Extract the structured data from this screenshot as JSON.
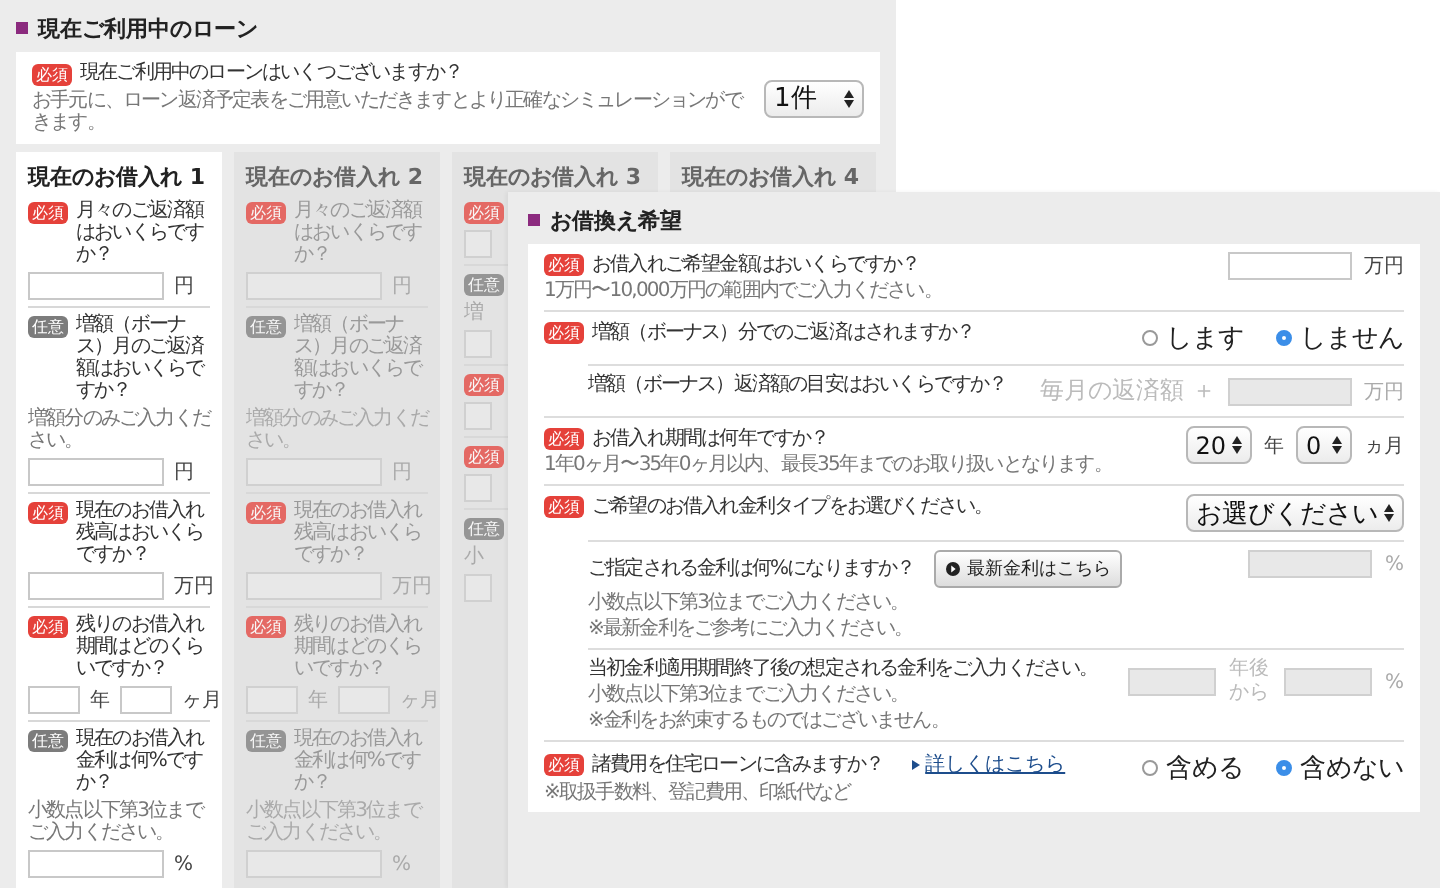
{
  "current_loans": {
    "heading": "現在ご利用中のローン",
    "count_question": {
      "badge": {
        "kind": "required",
        "text": "必須"
      },
      "question": "現在ご利用中のローンはいくつございますか？",
      "hint": "お手元に、ローン返済予定表をご用意いただきますとより正確なシミュレーションができます。",
      "select": "1件"
    },
    "columns": [
      {
        "title": "現在のお借入れ 1",
        "disabled": false,
        "items": [
          {
            "badge": {
              "kind": "required",
              "text": "必須"
            },
            "question": "月々のご返済額はおいくらですか？",
            "fields": [
              {
                "kind": "wide",
                "unit": "円"
              }
            ]
          },
          {
            "badge": {
              "kind": "optional",
              "text": "任意"
            },
            "question": "増額（ボーナス）月のご返済額はおいくらですか？",
            "hint": "増額分のみご入力ください。",
            "fields": [
              {
                "kind": "wide",
                "unit": "円"
              }
            ]
          },
          {
            "badge": {
              "kind": "required",
              "text": "必須"
            },
            "question": "現在のお借入れ残高はおいくらですか？",
            "fields": [
              {
                "kind": "wide",
                "unit": "万円"
              }
            ]
          },
          {
            "badge": {
              "kind": "required",
              "text": "必須"
            },
            "question": "残りのお借入れ期間はどのくらいですか？",
            "fields": [
              {
                "kind": "narrow",
                "unit": "年"
              },
              {
                "kind": "narrow",
                "unit": "ヶ月"
              }
            ]
          },
          {
            "badge": {
              "kind": "optional",
              "text": "任意"
            },
            "question": "現在のお借入れ金利は何%ですか？",
            "hint": "小数点以下第3位までご入力ください。",
            "fields": [
              {
                "kind": "wide",
                "unit": "%"
              }
            ]
          }
        ]
      },
      {
        "title": "現在のお借入れ 2",
        "disabled": true,
        "items": [
          {
            "badge": {
              "kind": "required",
              "text": "必須"
            },
            "question": "月々のご返済額はおいくらですか？",
            "fields": [
              {
                "kind": "wide",
                "unit": "円"
              }
            ]
          },
          {
            "badge": {
              "kind": "optional",
              "text": "任意"
            },
            "question": "増額（ボーナス）月のご返済額はおいくらですか？",
            "hint": "増額分のみご入力ください。",
            "fields": [
              {
                "kind": "wide",
                "unit": "円"
              }
            ]
          },
          {
            "badge": {
              "kind": "required",
              "text": "必須"
            },
            "question": "現在のお借入れ残高はおいくらですか？",
            "fields": [
              {
                "kind": "wide",
                "unit": "万円"
              }
            ]
          },
          {
            "badge": {
              "kind": "required",
              "text": "必須"
            },
            "question": "残りのお借入れ期間はどのくらいですか？",
            "fields": [
              {
                "kind": "narrow",
                "unit": "年"
              },
              {
                "kind": "narrow",
                "unit": "ヶ月"
              }
            ]
          },
          {
            "badge": {
              "kind": "optional",
              "text": "任意"
            },
            "question": "現在のお借入れ金利は何%ですか？",
            "hint": "小数点以下第3位までご入力ください。",
            "fields": [
              {
                "kind": "wide",
                "unit": "%"
              }
            ]
          }
        ]
      },
      {
        "title": "現在のお借入れ 3",
        "disabled": true,
        "items": [
          {
            "badge": {
              "kind": "required",
              "text": "必須"
            },
            "fields": [
              {
                "kind": "stub"
              }
            ]
          },
          {
            "badge": {
              "kind": "optional",
              "text": "任意"
            },
            "hint": "増",
            "fields": [
              {
                "kind": "stub"
              }
            ]
          },
          {
            "badge": {
              "kind": "required",
              "text": "必須"
            },
            "fields": [
              {
                "kind": "stub"
              }
            ]
          },
          {
            "badge": {
              "kind": "required",
              "text": "必須"
            },
            "fields": [
              {
                "kind": "stub"
              }
            ]
          },
          {
            "badge": {
              "kind": "optional",
              "text": "任意"
            },
            "hint": "小",
            "fields": [
              {
                "kind": "stub"
              }
            ]
          }
        ]
      },
      {
        "title": "現在のお借入れ 4",
        "disabled": true
      }
    ]
  },
  "refinance": {
    "heading": "お借換え希望",
    "rows": [
      {
        "kind": "main",
        "badge": {
          "kind": "required",
          "text": "必須"
        },
        "question": "お借入れご希望金額はおいくらですか？",
        "hints": [
          "1万円〜10,000万円の範囲内でご入力ください。"
        ],
        "disabled": false,
        "controls": [
          {
            "kind": "input"
          },
          {
            "kind": "unit",
            "text": "万円"
          }
        ]
      },
      {
        "kind": "main",
        "badge": {
          "kind": "required",
          "text": "必須"
        },
        "question": "増額（ボーナス）分でのご返済はされますか？",
        "controls": [
          {
            "kind": "radio",
            "text": "します",
            "selected": false
          },
          {
            "kind": "radio",
            "text": "しません",
            "selected": true
          }
        ]
      },
      {
        "kind": "sub",
        "question": "増額（ボーナス）返済額の目安はおいくらですか？",
        "disabled": true,
        "controls": [
          {
            "kind": "label",
            "text": "毎月の返済額 ＋"
          },
          {
            "kind": "input"
          },
          {
            "kind": "unit",
            "text": "万円"
          }
        ]
      },
      {
        "kind": "main",
        "badge": {
          "kind": "required",
          "text": "必須"
        },
        "question": "お借入れ期間は何年ですか？",
        "hints": [
          "1年0ヶ月〜35年0ヶ月以内、最長35年までのお取り扱いとなります。"
        ],
        "disabled": false,
        "controls": [
          {
            "kind": "select",
            "text": "20"
          },
          {
            "kind": "unit",
            "text": "年"
          },
          {
            "kind": "select",
            "text": "0"
          },
          {
            "kind": "unit",
            "text": "ヵ月"
          }
        ]
      },
      {
        "kind": "main",
        "badge": {
          "kind": "required",
          "text": "必須"
        },
        "question": "ご希望のお借入れ金利タイプをお選びください。",
        "controls": [
          {
            "kind": "select",
            "text": "お選びください"
          }
        ]
      },
      {
        "kind": "sub",
        "question": "ご指定される金利は何%になりますか？",
        "hints": [
          "小数点以下第3位までご入力ください。",
          "※最新金利をご参考にご入力ください。"
        ],
        "button": "最新金利はこちら",
        "disabled": true,
        "controls": [
          {
            "kind": "input"
          },
          {
            "kind": "unit",
            "text": "%"
          }
        ]
      },
      {
        "kind": "sub",
        "question": "当初金利適用期間終了後の想定される金利をご入力ください。",
        "hints": [
          "小数点以下第3位までご入力ください。",
          "※金利をお約束するものではございません。"
        ],
        "disabled": true,
        "controls": [
          {
            "kind": "small-input"
          },
          {
            "kind": "label",
            "text": "年後から"
          },
          {
            "kind": "small-input"
          },
          {
            "kind": "unit",
            "text": "%"
          }
        ]
      },
      {
        "kind": "main",
        "badge": {
          "kind": "required",
          "text": "必須"
        },
        "question": "諸費用を住宅ローンに含みますか？",
        "link": "詳しくはこちら",
        "hints": [
          "※取扱手数料、登記費用、印紙代など"
        ],
        "controls": [
          {
            "kind": "radio",
            "text": "含める",
            "selected": false
          },
          {
            "kind": "radio",
            "text": "含めない",
            "selected": true
          }
        ]
      }
    ]
  }
}
